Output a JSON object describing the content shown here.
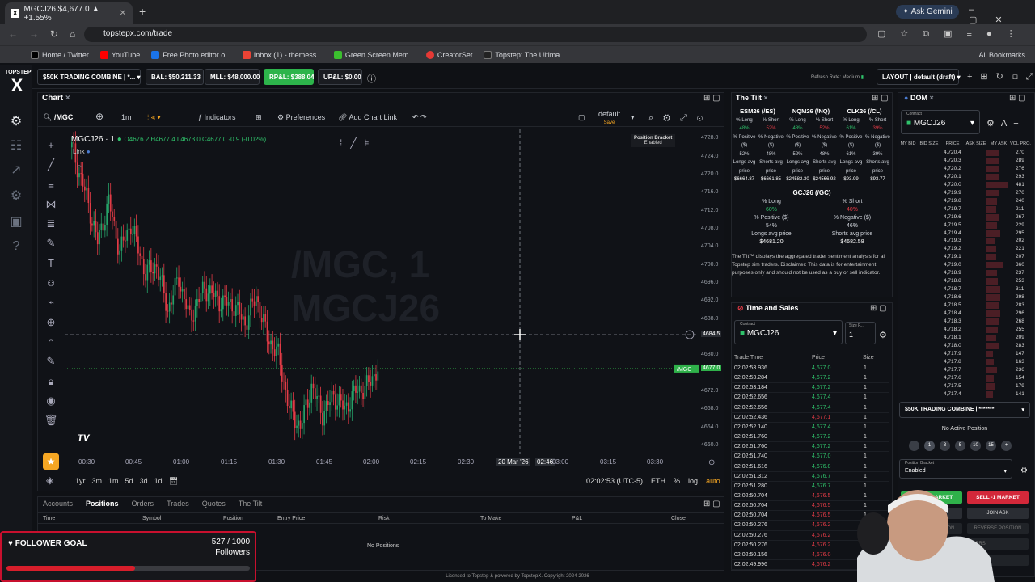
{
  "browser": {
    "tab_title": "MGCJ26 $4,677.0 ▲ +1.55%",
    "url": "topstepx.com/trade",
    "ask_gemini": "Ask Gemini",
    "bookmarks": [
      "Home / Twitter",
      "YouTube",
      "Free Photo editor o...",
      "Inbox (1) - themess...",
      "Green Screen Mem...",
      "CreatorSet",
      "Topstep: The Ultima..."
    ],
    "all_bookmarks": "All Bookmarks"
  },
  "logo": {
    "top": "TOPSTEP",
    "mark": "X"
  },
  "topbar": {
    "account": "$50K TRADING COMBINE | *...",
    "bal": "BAL: $50,211.33",
    "mll": "MLL: $48,000.00",
    "rp": "RP&L: $388.04",
    "up": "UP&L: $0.00",
    "refresh": "Refresh Rate: Medium",
    "layout": "LAYOUT | default (draft)"
  },
  "chart": {
    "tab": "Chart",
    "symbol": "/MGC",
    "interval": "1m",
    "indicators": "Indicators",
    "preferences": "Preferences",
    "add_link": "Add Chart Link",
    "layout_name": "default",
    "layout_sub": "Save",
    "legend_title": "MGCJ26 · 1",
    "ohlc": "O4676.2 H4677.4 L4673.0 C4677.0 -0.9 (-0.02%)",
    "link": "Link",
    "watermark1": "/MGC, 1",
    "watermark2": "MGCJ26",
    "position_bracket": "Position Bracket",
    "bracket_state": "Enabled",
    "price_ticks": [
      "4728.0",
      "4724.0",
      "4720.0",
      "4716.0",
      "4712.0",
      "4708.0",
      "4704.0",
      "4700.0",
      "4696.0",
      "4692.0",
      "4688.0",
      "4684.5",
      "4680.0",
      "4677.0",
      "4672.0",
      "4668.0",
      "4664.0",
      "4660.0"
    ],
    "time_ticks": [
      "00:30",
      "00:45",
      "01:00",
      "01:15",
      "01:30",
      "01:45",
      "02:00",
      "02:15",
      "02:30",
      "20 Mar '26",
      "02:46",
      "03:00",
      "03:15",
      "03:30"
    ],
    "last_tag": "/MGC",
    "ranges": [
      "1yr",
      "3m",
      "1m",
      "5d",
      "3d",
      "1d"
    ],
    "clock": "02:02:53 (UTC-5)",
    "eth": "ETH",
    "pct": "%",
    "log": "log",
    "auto": "auto"
  },
  "bottom": {
    "tabs": [
      "Accounts",
      "Positions",
      "Orders",
      "Trades",
      "Quotes",
      "The Tilt"
    ],
    "cols": [
      "Time",
      "Symbol",
      "Position",
      "Entry Price",
      "Risk",
      "To Make",
      "P&L",
      "Close"
    ],
    "empty": "No Positions"
  },
  "footer": "Licensed to Topstep & powered by TopstepX. Copyright 2024-2026",
  "tilt": {
    "title": "The Tilt",
    "markets": [
      {
        "name": "ESM26 (/ES)",
        "long": "48%",
        "short": "52%",
        "pos": "52%",
        "neg": "48%",
        "lavg": "$6664.87",
        "savg": "$6661.85"
      },
      {
        "name": "NQM26 (/NQ)",
        "long": "48%",
        "short": "52%",
        "pos": "52%",
        "neg": "48%",
        "lavg": "$24582.30",
        "savg": "$24566.92"
      },
      {
        "name": "CLK26 (/CL)",
        "long": "61%",
        "short": "39%",
        "pos": "61%",
        "neg": "39%",
        "lavg": "$93.99",
        "savg": "$93.77"
      }
    ],
    "labels": {
      "long": "% Long",
      "short": "% Short",
      "pos": "% Positive ($)",
      "neg": "% Negative ($)",
      "lavg": "Longs avg price",
      "savg": "Shorts avg price"
    },
    "gc": {
      "name": "GCJ26 (/GC)",
      "long": "60%",
      "short": "40%",
      "pos": "54%",
      "neg": "46%",
      "lavg": "$4681.20",
      "savg": "$4682.58"
    },
    "disclaimer": "The Tilt™ displays the aggregated trader sentiment analysis for all Topstep sim traders. Disclaimer: This data is for entertainment purposes only and should not be used as a buy or sell indicator."
  },
  "tas": {
    "title": "Time and Sales",
    "contract_label": "Contract",
    "contract": "MGCJ26",
    "size_label": "Size F...",
    "size": "1",
    "cols": [
      "Trade Time",
      "Price",
      "Size"
    ],
    "rows": [
      [
        "02:02:53.936",
        "4,677.0",
        "1",
        "g"
      ],
      [
        "02:02:53.284",
        "4,677.2",
        "1",
        "g"
      ],
      [
        "02:02:53.184",
        "4,677.2",
        "1",
        "g"
      ],
      [
        "02:02:52.656",
        "4,677.4",
        "1",
        "g"
      ],
      [
        "02:02:52.656",
        "4,677.4",
        "1",
        "g"
      ],
      [
        "02:02:52.436",
        "4,677.1",
        "1",
        "r"
      ],
      [
        "02:02:52.140",
        "4,677.4",
        "1",
        "g"
      ],
      [
        "02:02:51.760",
        "4,677.2",
        "1",
        "g"
      ],
      [
        "02:02:51.760",
        "4,677.2",
        "1",
        "g"
      ],
      [
        "02:02:51.740",
        "4,677.0",
        "1",
        "g"
      ],
      [
        "02:02:51.616",
        "4,676.8",
        "1",
        "g"
      ],
      [
        "02:02:51.312",
        "4,676.7",
        "1",
        "g"
      ],
      [
        "02:02:51.280",
        "4,676.7",
        "1",
        "g"
      ],
      [
        "02:02:50.704",
        "4,676.5",
        "1",
        "r"
      ],
      [
        "02:02:50.704",
        "4,676.5",
        "1",
        "r"
      ],
      [
        "02:02:50.704",
        "4,676.5",
        "1",
        "r"
      ],
      [
        "02:02:50.276",
        "4,676.2",
        "1",
        "r"
      ],
      [
        "02:02:50.276",
        "4,676.2",
        "1",
        "r"
      ],
      [
        "02:02:50.276",
        "4,676.2",
        "1",
        "r"
      ],
      [
        "02:02:50.156",
        "4,676.0",
        "1",
        "r"
      ],
      [
        "02:02:49.996",
        "4,676.2",
        "1",
        "r"
      ]
    ]
  },
  "dom": {
    "title": "DOM",
    "contract_label": "Contract",
    "contract": "MGCJ26",
    "cols": [
      "MY BID",
      "BID SIZE",
      "PRICE",
      "ASK SIZE",
      "MY ASK",
      "VOL PRO."
    ],
    "rows": [
      [
        "4,720.4",
        "270"
      ],
      [
        "4,720.3",
        "289"
      ],
      [
        "4,720.2",
        "276"
      ],
      [
        "4,720.1",
        "293"
      ],
      [
        "4,720.0",
        "481"
      ],
      [
        "4,719.9",
        "270"
      ],
      [
        "4,719.8",
        "240"
      ],
      [
        "4,719.7",
        "211"
      ],
      [
        "4,719.6",
        "267"
      ],
      [
        "4,719.5",
        "229"
      ],
      [
        "4,719.4",
        "295"
      ],
      [
        "4,719.3",
        "202"
      ],
      [
        "4,719.2",
        "221"
      ],
      [
        "4,719.1",
        "207"
      ],
      [
        "4,719.0",
        "360"
      ],
      [
        "4,718.9",
        "237"
      ],
      [
        "4,718.8",
        "253"
      ],
      [
        "4,718.7",
        "311"
      ],
      [
        "4,718.6",
        "298"
      ],
      [
        "4,718.5",
        "283"
      ],
      [
        "4,718.4",
        "296"
      ],
      [
        "4,718.3",
        "268"
      ],
      [
        "4,718.2",
        "255"
      ],
      [
        "4,718.1",
        "209"
      ],
      [
        "4,718.0",
        "283"
      ],
      [
        "4,717.9",
        "147"
      ],
      [
        "4,717.8",
        "163"
      ],
      [
        "4,717.7",
        "236"
      ],
      [
        "4,717.6",
        "154"
      ],
      [
        "4,717.5",
        "179"
      ],
      [
        "4,717.4",
        "141"
      ]
    ],
    "account": "$50K TRADING COMBINE | *******",
    "no_position": "No Active Position",
    "qty": [
      "1",
      "3",
      "5",
      "10",
      "15"
    ],
    "bracket_label": "Position Bracket",
    "bracket": "Enabled",
    "buy": "BUY +1 MARKET",
    "sell": "SELL -1 MARKET",
    "join_bid": "JOIN BID",
    "join_ask": "JOIN ASK",
    "flatten": "FLATTEN POSITION",
    "reverse": "REVERSE POSITION",
    "cancel_orders": "CANCEL ORDERS",
    "cancel_all": "CANCEL ALL"
  },
  "follower": {
    "label": "FOLLOWER GOAL",
    "count": "527 / 1000",
    "unit": "Followers",
    "progress": 0.527
  }
}
